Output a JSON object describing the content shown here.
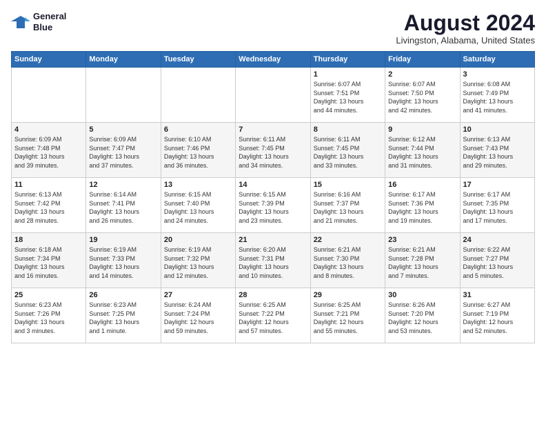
{
  "header": {
    "logo_line1": "General",
    "logo_line2": "Blue",
    "month_year": "August 2024",
    "location": "Livingston, Alabama, United States"
  },
  "days_of_week": [
    "Sunday",
    "Monday",
    "Tuesday",
    "Wednesday",
    "Thursday",
    "Friday",
    "Saturday"
  ],
  "weeks": [
    [
      {
        "num": "",
        "info": ""
      },
      {
        "num": "",
        "info": ""
      },
      {
        "num": "",
        "info": ""
      },
      {
        "num": "",
        "info": ""
      },
      {
        "num": "1",
        "info": "Sunrise: 6:07 AM\nSunset: 7:51 PM\nDaylight: 13 hours\nand 44 minutes."
      },
      {
        "num": "2",
        "info": "Sunrise: 6:07 AM\nSunset: 7:50 PM\nDaylight: 13 hours\nand 42 minutes."
      },
      {
        "num": "3",
        "info": "Sunrise: 6:08 AM\nSunset: 7:49 PM\nDaylight: 13 hours\nand 41 minutes."
      }
    ],
    [
      {
        "num": "4",
        "info": "Sunrise: 6:09 AM\nSunset: 7:48 PM\nDaylight: 13 hours\nand 39 minutes."
      },
      {
        "num": "5",
        "info": "Sunrise: 6:09 AM\nSunset: 7:47 PM\nDaylight: 13 hours\nand 37 minutes."
      },
      {
        "num": "6",
        "info": "Sunrise: 6:10 AM\nSunset: 7:46 PM\nDaylight: 13 hours\nand 36 minutes."
      },
      {
        "num": "7",
        "info": "Sunrise: 6:11 AM\nSunset: 7:45 PM\nDaylight: 13 hours\nand 34 minutes."
      },
      {
        "num": "8",
        "info": "Sunrise: 6:11 AM\nSunset: 7:45 PM\nDaylight: 13 hours\nand 33 minutes."
      },
      {
        "num": "9",
        "info": "Sunrise: 6:12 AM\nSunset: 7:44 PM\nDaylight: 13 hours\nand 31 minutes."
      },
      {
        "num": "10",
        "info": "Sunrise: 6:13 AM\nSunset: 7:43 PM\nDaylight: 13 hours\nand 29 minutes."
      }
    ],
    [
      {
        "num": "11",
        "info": "Sunrise: 6:13 AM\nSunset: 7:42 PM\nDaylight: 13 hours\nand 28 minutes."
      },
      {
        "num": "12",
        "info": "Sunrise: 6:14 AM\nSunset: 7:41 PM\nDaylight: 13 hours\nand 26 minutes."
      },
      {
        "num": "13",
        "info": "Sunrise: 6:15 AM\nSunset: 7:40 PM\nDaylight: 13 hours\nand 24 minutes."
      },
      {
        "num": "14",
        "info": "Sunrise: 6:15 AM\nSunset: 7:39 PM\nDaylight: 13 hours\nand 23 minutes."
      },
      {
        "num": "15",
        "info": "Sunrise: 6:16 AM\nSunset: 7:37 PM\nDaylight: 13 hours\nand 21 minutes."
      },
      {
        "num": "16",
        "info": "Sunrise: 6:17 AM\nSunset: 7:36 PM\nDaylight: 13 hours\nand 19 minutes."
      },
      {
        "num": "17",
        "info": "Sunrise: 6:17 AM\nSunset: 7:35 PM\nDaylight: 13 hours\nand 17 minutes."
      }
    ],
    [
      {
        "num": "18",
        "info": "Sunrise: 6:18 AM\nSunset: 7:34 PM\nDaylight: 13 hours\nand 16 minutes."
      },
      {
        "num": "19",
        "info": "Sunrise: 6:19 AM\nSunset: 7:33 PM\nDaylight: 13 hours\nand 14 minutes."
      },
      {
        "num": "20",
        "info": "Sunrise: 6:19 AM\nSunset: 7:32 PM\nDaylight: 13 hours\nand 12 minutes."
      },
      {
        "num": "21",
        "info": "Sunrise: 6:20 AM\nSunset: 7:31 PM\nDaylight: 13 hours\nand 10 minutes."
      },
      {
        "num": "22",
        "info": "Sunrise: 6:21 AM\nSunset: 7:30 PM\nDaylight: 13 hours\nand 8 minutes."
      },
      {
        "num": "23",
        "info": "Sunrise: 6:21 AM\nSunset: 7:28 PM\nDaylight: 13 hours\nand 7 minutes."
      },
      {
        "num": "24",
        "info": "Sunrise: 6:22 AM\nSunset: 7:27 PM\nDaylight: 13 hours\nand 5 minutes."
      }
    ],
    [
      {
        "num": "25",
        "info": "Sunrise: 6:23 AM\nSunset: 7:26 PM\nDaylight: 13 hours\nand 3 minutes."
      },
      {
        "num": "26",
        "info": "Sunrise: 6:23 AM\nSunset: 7:25 PM\nDaylight: 13 hours\nand 1 minute."
      },
      {
        "num": "27",
        "info": "Sunrise: 6:24 AM\nSunset: 7:24 PM\nDaylight: 12 hours\nand 59 minutes."
      },
      {
        "num": "28",
        "info": "Sunrise: 6:25 AM\nSunset: 7:22 PM\nDaylight: 12 hours\nand 57 minutes."
      },
      {
        "num": "29",
        "info": "Sunrise: 6:25 AM\nSunset: 7:21 PM\nDaylight: 12 hours\nand 55 minutes."
      },
      {
        "num": "30",
        "info": "Sunrise: 6:26 AM\nSunset: 7:20 PM\nDaylight: 12 hours\nand 53 minutes."
      },
      {
        "num": "31",
        "info": "Sunrise: 6:27 AM\nSunset: 7:19 PM\nDaylight: 12 hours\nand 52 minutes."
      }
    ]
  ]
}
